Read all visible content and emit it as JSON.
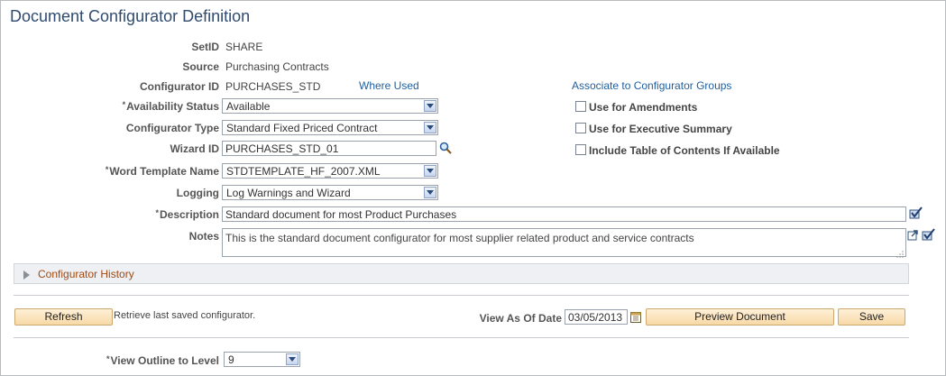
{
  "page": {
    "title": "Document Configurator Definition"
  },
  "form": {
    "setid_label": "SetID",
    "setid_value": "SHARE",
    "source_label": "Source",
    "source_value": "Purchasing Contracts",
    "configurator_id_label": "Configurator ID",
    "configurator_id_value": "PURCHASES_STD",
    "where_used": "Where Used",
    "associate_groups": "Associate to Configurator Groups",
    "availability_label": "Availability Status",
    "availability_value": "Available",
    "configurator_type_label": "Configurator Type",
    "configurator_type_value": "Standard Fixed Priced Contract",
    "wizard_label": "Wizard ID",
    "wizard_value": "PURCHASES_STD_01",
    "word_template_label": "Word Template Name",
    "word_template_value": "STDTEMPLATE_HF_2007.XML",
    "logging_label": "Logging",
    "logging_value": "Log Warnings and Wizard",
    "description_label": "Description",
    "description_value": "Standard document for most Product Purchases",
    "notes_label": "Notes",
    "notes_value": "This is the standard document configurator for most supplier related product and service contracts",
    "required_mark": "*"
  },
  "options": {
    "amendments": "Use for Amendments",
    "executive_summary": "Use for Executive Summary",
    "toc": "Include Table of Contents If Available",
    "amendments_checked": false,
    "executive_summary_checked": false,
    "toc_checked": false
  },
  "history": {
    "title": "Configurator History"
  },
  "actions": {
    "refresh": "Refresh",
    "refresh_note": "Retrieve last saved configurator.",
    "view_as_of_label": "View As Of Date",
    "view_as_of_value": "03/05/2013",
    "preview": "Preview Document",
    "save": "Save"
  },
  "outline": {
    "label": "View Outline to Level",
    "value": "9"
  },
  "colors": {
    "title": "#2f4b6f",
    "link": "#1f5e9e",
    "section_title": "#a04a13",
    "button_bg": "#f7d9a6"
  }
}
